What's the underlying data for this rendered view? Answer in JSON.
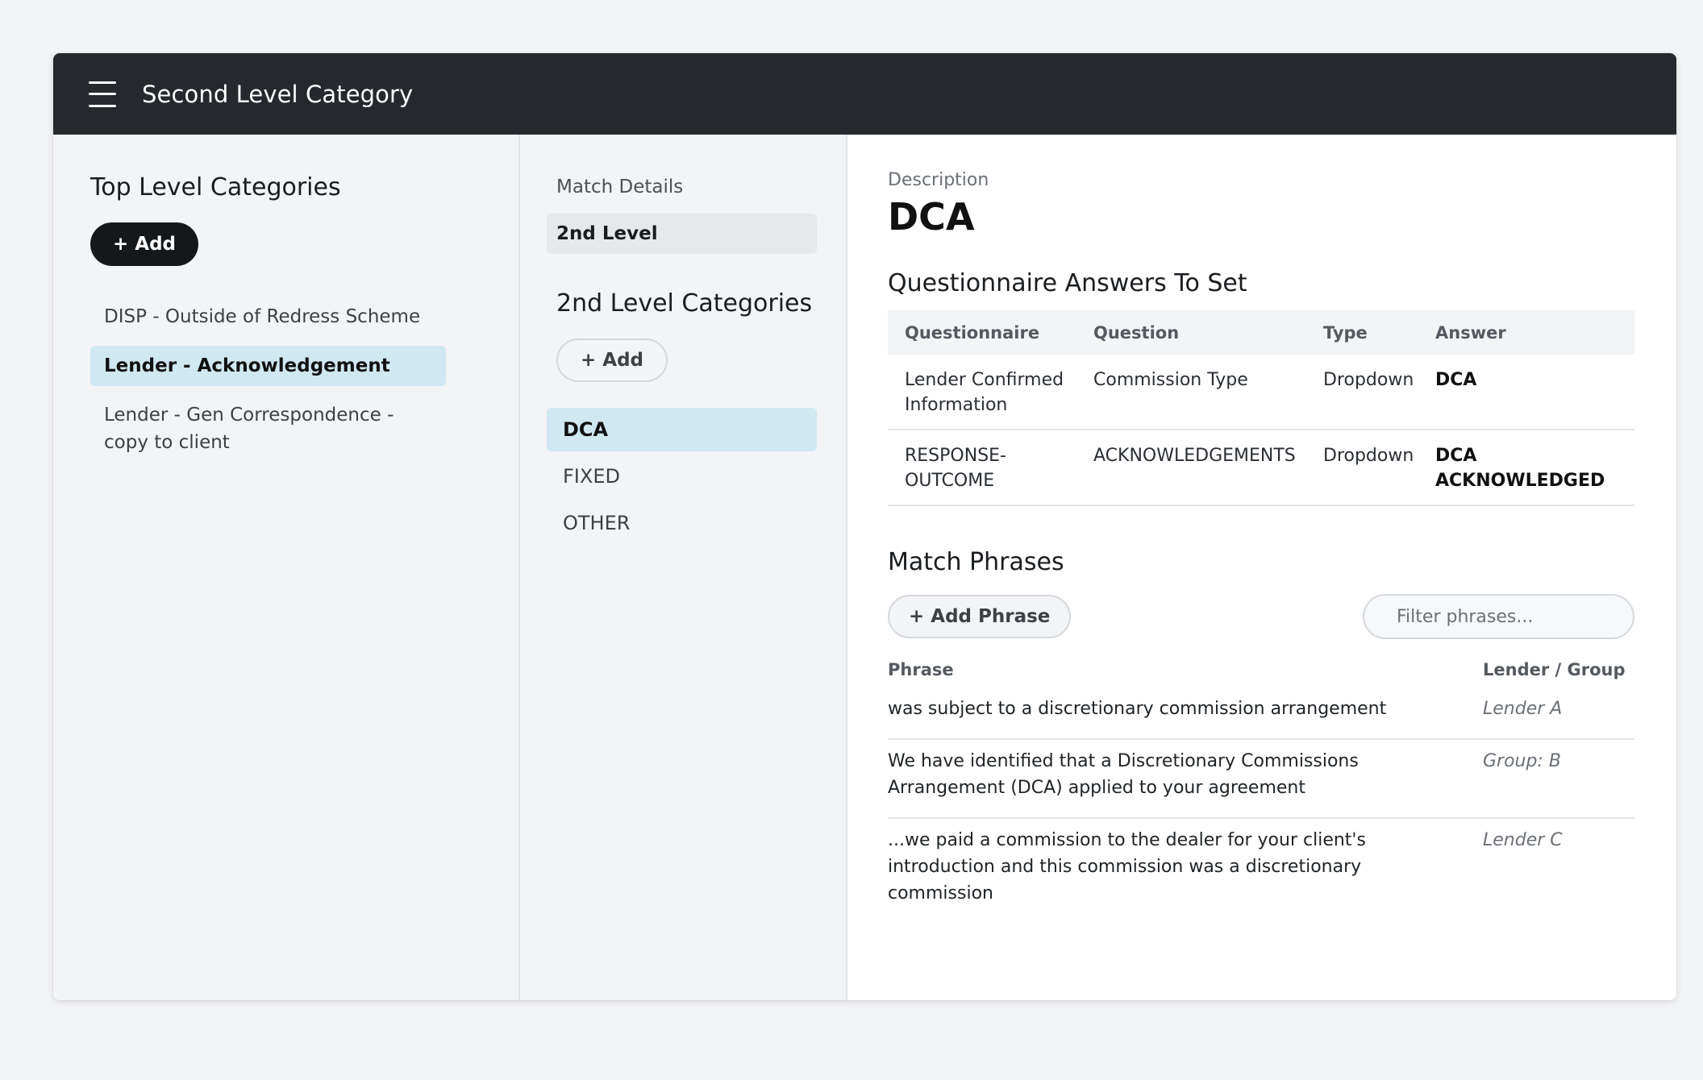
{
  "header": {
    "title": "Second Level Category",
    "menu_icon": "hamburger-menu-icon"
  },
  "top_level": {
    "title": "Top Level Categories",
    "add_label": "+ Add",
    "items": [
      {
        "label": "DISP - Outside of Redress Scheme",
        "active": false
      },
      {
        "label": "Lender - Acknowledgement",
        "active": true
      },
      {
        "label": "Lender - Gen Correspondence - copy to client",
        "active": false
      }
    ]
  },
  "second_level": {
    "match_details_label": "Match Details",
    "level_tab_label": "2nd Level",
    "title": "2nd Level Categories",
    "add_label": "+ Add",
    "items": [
      {
        "label": "DCA",
        "active": true
      },
      {
        "label": "FIXED",
        "active": false
      },
      {
        "label": "OTHER",
        "active": false
      }
    ]
  },
  "detail": {
    "description_label": "Description",
    "description_value": "DCA",
    "questionnaire": {
      "title": "Questionnaire Answers To Set",
      "columns": [
        "Questionnaire",
        "Question",
        "Type",
        "Answer"
      ],
      "rows": [
        [
          "Lender Confirmed Information",
          "Commission Type",
          "Dropdown",
          "DCA"
        ],
        [
          "RESPONSE-OUTCOME",
          "ACKNOWLEDGEMENTS",
          "Dropdown",
          "DCA ACKNOWLEDGED"
        ]
      ]
    },
    "phrases": {
      "title": "Match Phrases",
      "add_label": "+ Add Phrase",
      "filter_placeholder": "Filter phrases...",
      "columns": [
        "Phrase",
        "Lender / Group"
      ],
      "rows": [
        [
          "was subject to a discretionary commission arrangement",
          "Lender A"
        ],
        [
          "We have identified that a Discretionary Commissions Arrangement (DCA) applied to your agreement",
          "Group: B"
        ],
        [
          "...we paid a commission to the dealer for your client's introduction and this commission was a discretionary commission",
          "Lender C"
        ]
      ]
    }
  },
  "colors": {
    "topbar": "#25292e",
    "active_item": "#cfe8f2",
    "dark_button": "#15181b"
  }
}
